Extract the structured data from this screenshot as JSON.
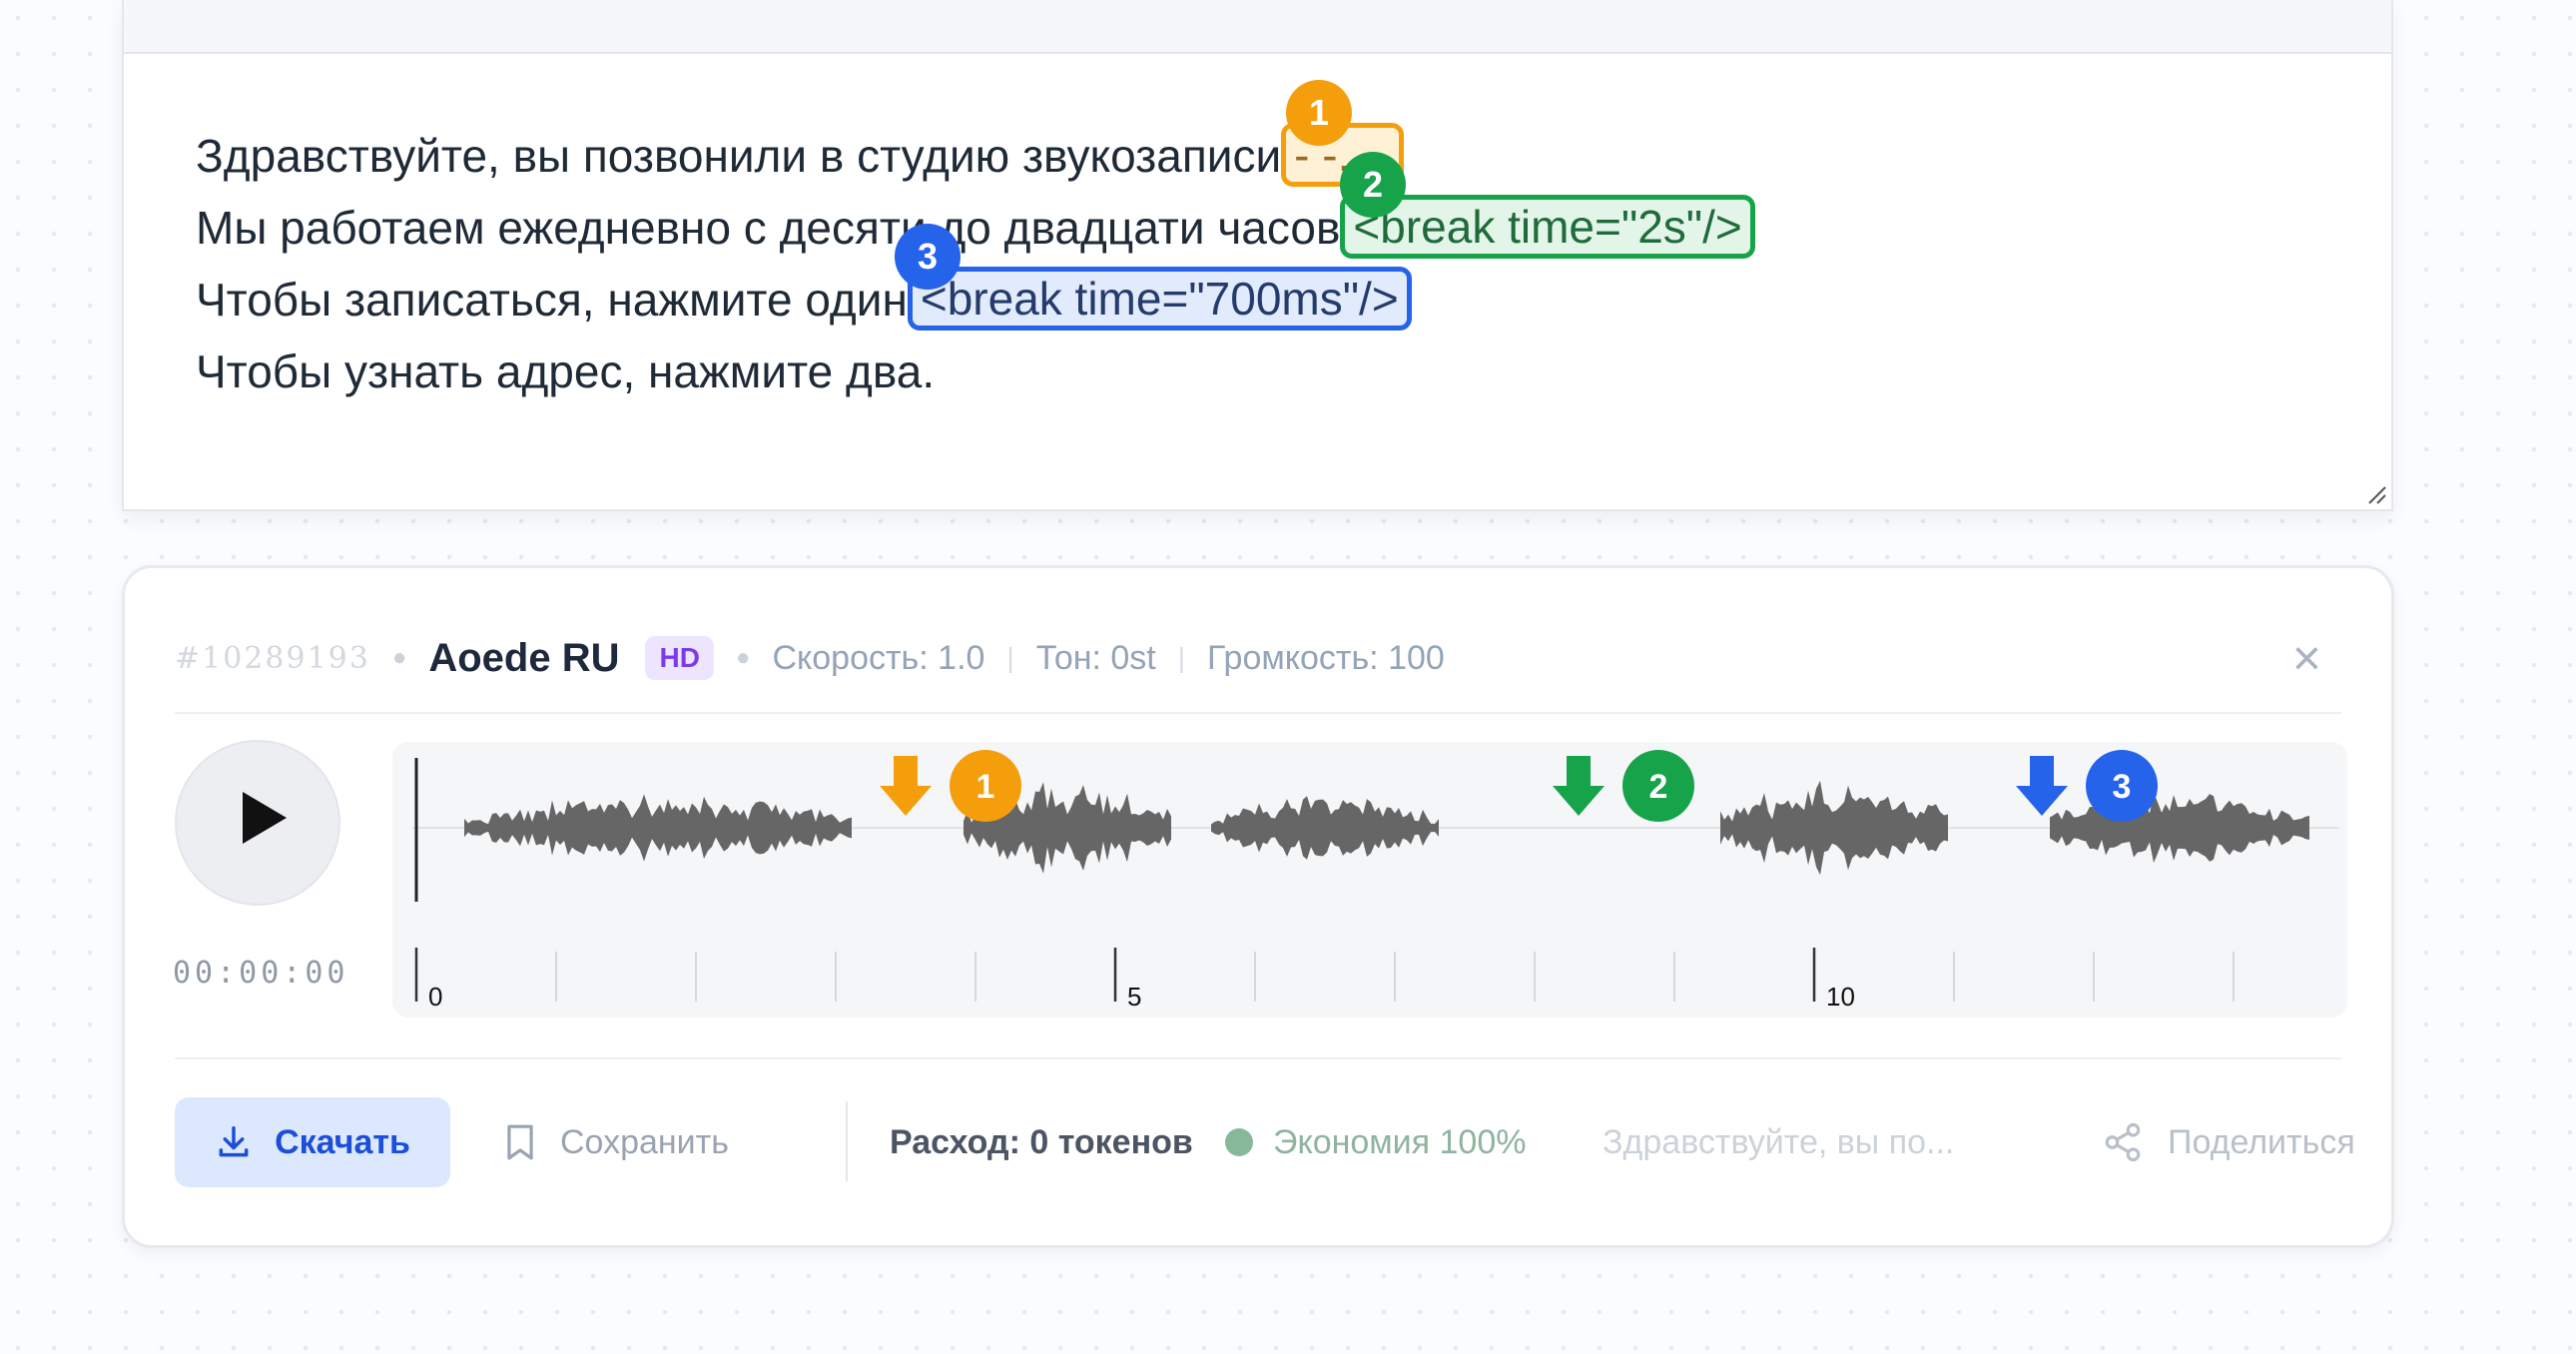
{
  "editor": {
    "line1_text": "Здравствуйте, вы позвонили в студию звукозаписи",
    "tag1": "- -. -.",
    "line2_text": "Мы работаем ежедневно с десяти до двадцати часов",
    "tag2": "<break time=\"2s\"/>",
    "line3_text": "Чтобы записаться, нажмите один",
    "tag3": "<break time=\"700ms\"/>",
    "line4_text": "Чтобы узнать адрес, нажмите два.",
    "badges": [
      "1",
      "2",
      "3"
    ]
  },
  "player": {
    "id": "#10289193",
    "voice": "Aoede RU",
    "quality": "HD",
    "speed": "Скорость: 1.0",
    "tone": "Тон: 0st",
    "volume": "Громкость: 100",
    "timecode": "00:00:00",
    "timeline_labels": [
      "0",
      "5",
      "10"
    ],
    "markers": [
      "1",
      "2",
      "3"
    ],
    "download_label": "Скачать",
    "save_label": "Сохранить",
    "cost_label": "Расход: 0 токенов",
    "economy_label": "Экономия 100%",
    "preview_text": "Здравствуйте, вы по...",
    "share_label": "Поделиться"
  },
  "colors": {
    "orange": "#f59e0b",
    "green": "#16a34a",
    "blue": "#2563eb",
    "accent": "#1d4ed8",
    "waveform": "#666666"
  },
  "icons": [
    "download-icon",
    "bookmark-icon",
    "share-icon",
    "close-icon",
    "play-icon"
  ]
}
